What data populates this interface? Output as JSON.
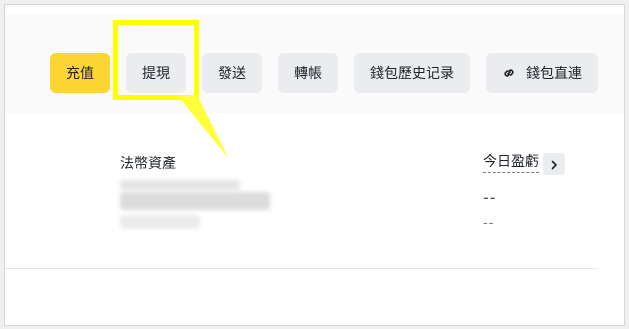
{
  "toolbar": {
    "buttons": [
      {
        "label": "充值",
        "style": "primary"
      },
      {
        "label": "提現",
        "style": "secondary"
      },
      {
        "label": "發送",
        "style": "secondary"
      },
      {
        "label": "轉帳",
        "style": "secondary"
      },
      {
        "label": "錢包歷史记录",
        "style": "secondary"
      },
      {
        "label": "錢包直連",
        "style": "secondary",
        "icon": "link-icon"
      }
    ]
  },
  "fiat": {
    "label": "法幣資產"
  },
  "pnl": {
    "label": "今日盈虧",
    "value": "--",
    "sub_value": "--"
  },
  "colors": {
    "accent": "#fcd535",
    "highlight": "#ffff00",
    "button_bg": "#eaecef"
  }
}
